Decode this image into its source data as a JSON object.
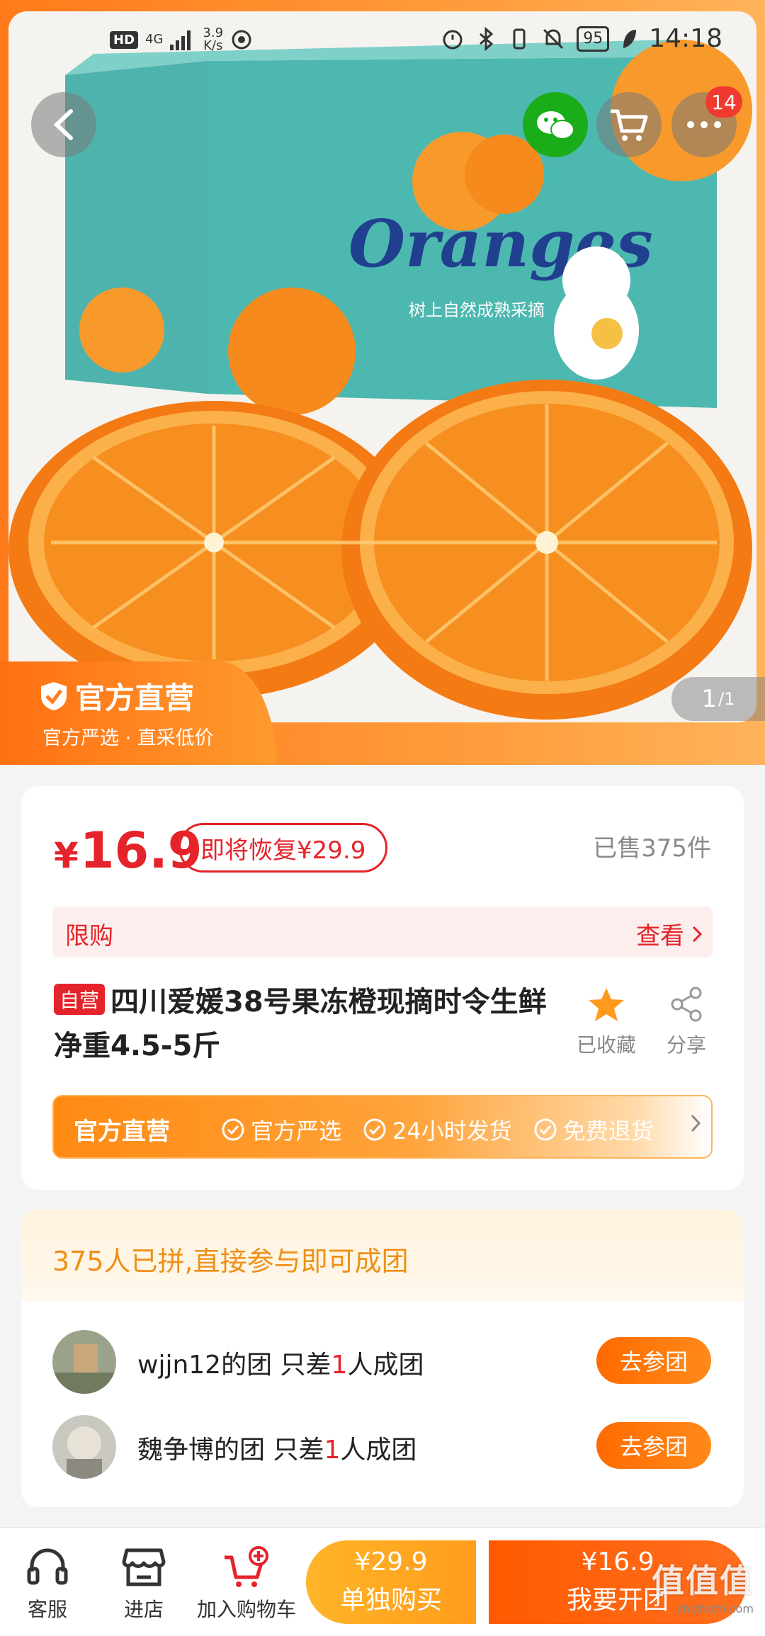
{
  "status_bar": {
    "hd": "HD",
    "network": "4G",
    "speed_value": "3.9",
    "speed_unit": "K/s",
    "battery": "95",
    "time": "14:18"
  },
  "hero": {
    "cart_badge": "14",
    "official_title": "官方直营",
    "official_sub": "官方严选 · 直采低价",
    "page_current": "1",
    "page_total": "/1"
  },
  "product": {
    "price_symbol": "¥",
    "price": "16.9",
    "restore_text": "即将恢复¥29.9",
    "sold_text": "已售375件",
    "limit_label": "限购",
    "limit_link": "查看",
    "self_tag": "自营",
    "title": "四川爱媛38号果冻橙现摘时令生鲜净重4.5-5斤",
    "fav_label": "已收藏",
    "share_label": "分享",
    "guarantee_title": "官方直营",
    "guarantees": [
      "官方严选",
      "24小时发货",
      "免费退货"
    ]
  },
  "group": {
    "header": "375人已拼,直接参与即可成团",
    "rows": [
      {
        "prefix": "wjjn12的团 只差",
        "num": "1",
        "suffix": "人成团",
        "button": "去参团"
      },
      {
        "prefix": "魏争博的团 只差",
        "num": "1",
        "suffix": "人成团",
        "button": "去参团"
      }
    ]
  },
  "bottom_bar": {
    "service": "客服",
    "store": "进店",
    "add_cart": "加入购物车",
    "alone_price": "¥29.9",
    "alone_label": "单独购买",
    "group_price": "¥16.9",
    "group_label": "我要开团"
  },
  "watermark": {
    "main": "值值值",
    "sub": "zhizhizhi.com"
  },
  "colors": {
    "accent": "#ff6a00",
    "price_red": "#e5232a",
    "group_orange": "#ee9018"
  }
}
